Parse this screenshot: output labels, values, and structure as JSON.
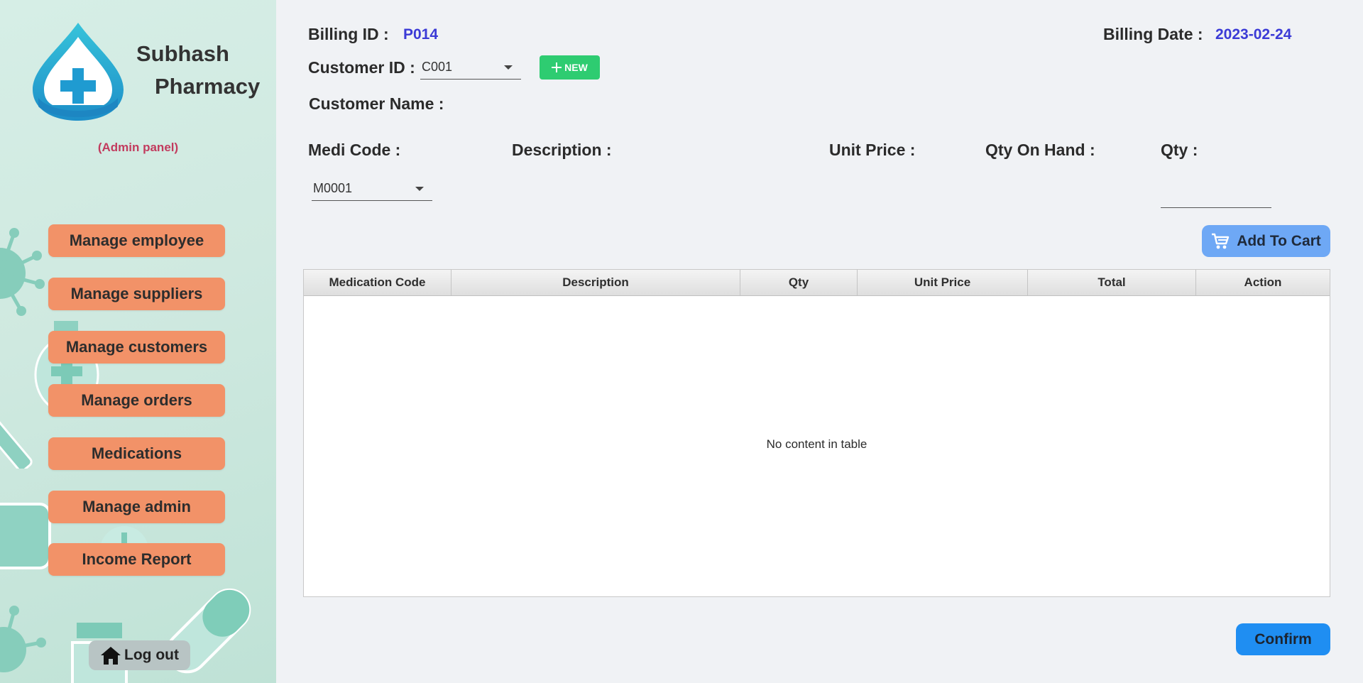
{
  "sidebar": {
    "brand_line1": "Subhash",
    "brand_line2": "Pharmacy",
    "admin_panel": "(Admin panel)",
    "nav": [
      {
        "label": "Manage employee"
      },
      {
        "label": "Manage suppliers"
      },
      {
        "label": "Manage customers"
      },
      {
        "label": "Manage orders"
      },
      {
        "label": "Medications"
      },
      {
        "label": "Manage admin"
      },
      {
        "label": "Income Report"
      }
    ],
    "logout_label": "Log out",
    "logout_icon": "home-icon",
    "logo_icon": "pharmacy-drop-cross-icon"
  },
  "billing": {
    "id_label": "Billing ID :",
    "id_value": "P014",
    "date_label": "Billing Date :",
    "date_value": "2023-02-24",
    "customer_id_label": "Customer ID :",
    "customer_id_value": "C001",
    "new_button_label": "NEW",
    "customer_name_label": "Customer Name :"
  },
  "item": {
    "medi_code_label": "Medi Code :",
    "medi_code_value": "M0001",
    "description_label": "Description :",
    "unit_price_label": "Unit Price :",
    "qty_on_hand_label": "Qty On Hand :",
    "qty_label": "Qty :",
    "qty_value": "",
    "add_to_cart_label": "Add To Cart"
  },
  "table": {
    "columns": [
      "Medication Code",
      "Description",
      "Qty",
      "Unit Price",
      "Total",
      "Action"
    ],
    "rows": [],
    "empty_text": "No content in table"
  },
  "confirm_label": "Confirm",
  "colors": {
    "nav_button": "#f29268",
    "accent_blue_text": "#3b3bd6",
    "new_button": "#2ecc71",
    "add_to_cart_button": "#6ea8f5",
    "confirm_button": "#1f8ef2",
    "admin_panel_text": "#c23b5e"
  }
}
